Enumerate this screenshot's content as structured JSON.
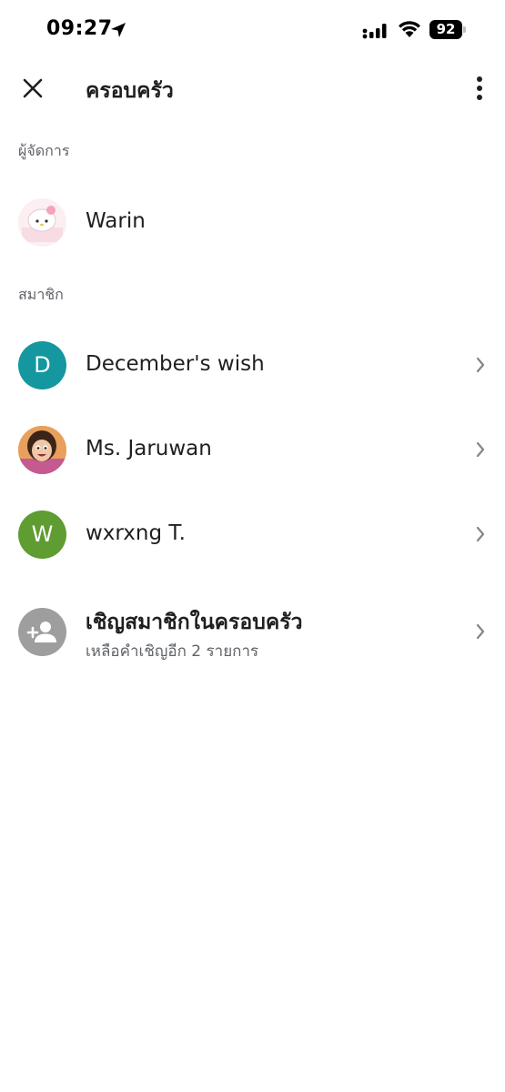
{
  "status_bar": {
    "time": "09:27",
    "battery": "92"
  },
  "app_bar": {
    "title": "ครอบครัว"
  },
  "sections": {
    "manager_label": "ผู้จัดการ",
    "members_label": "สมาชิก"
  },
  "manager": {
    "name": "Warin"
  },
  "members": [
    {
      "name": "December's wish",
      "initial": "D",
      "color": "#14979f"
    },
    {
      "name": "Ms. Jaruwan"
    },
    {
      "name": "wxrxng T.",
      "initial": "W",
      "color": "#5f9c31"
    }
  ],
  "invite": {
    "title": "เชิญสมาชิกในครอบครัว",
    "subtitle": "เหลือคำเชิญอีก 2 รายการ"
  },
  "colors": {
    "secondary_text": "#5f6368",
    "invite_avatar": "#9e9e9e",
    "chevron": "#80868b"
  }
}
